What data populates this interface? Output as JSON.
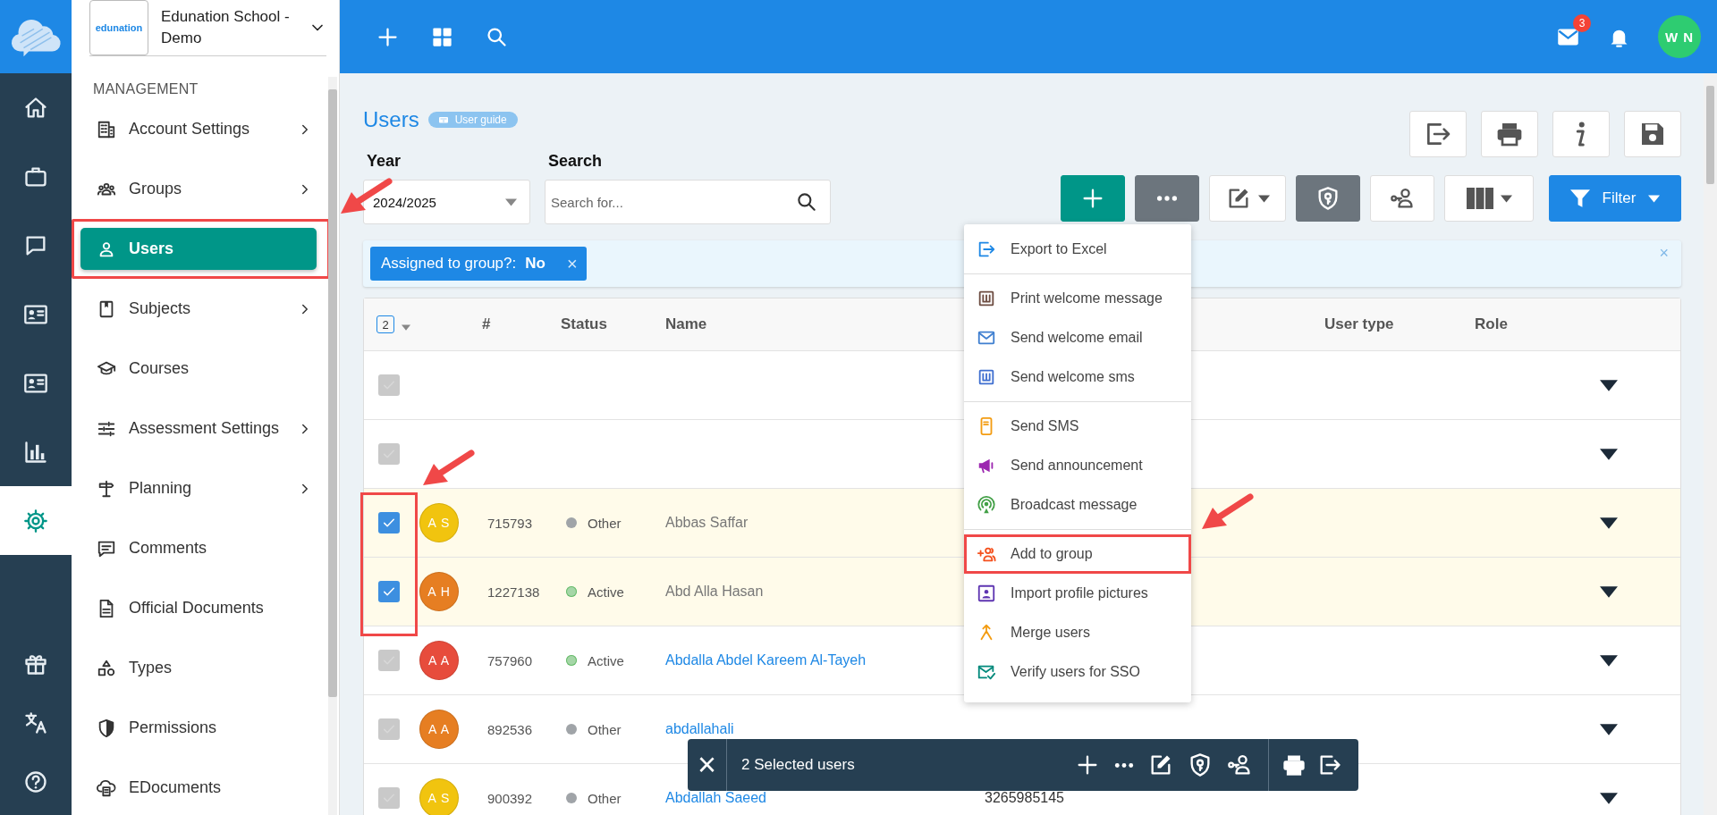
{
  "rail": [
    {
      "selected": false
    },
    {
      "selected": false
    },
    {
      "selected": false
    },
    {
      "selected": false
    },
    {
      "selected": false
    },
    {
      "selected": false
    },
    {
      "selected": true
    },
    {
      "selected": false
    },
    {
      "selected": false
    },
    {
      "selected": false
    }
  ],
  "organization": {
    "logo_text": "edunation",
    "name": "Edunation School - Demo"
  },
  "sidebar": {
    "section": "MANAGEMENT",
    "items": [
      {
        "label": "Account Settings",
        "has_children": true,
        "selected": false
      },
      {
        "label": "Groups",
        "has_children": true,
        "selected": false
      },
      {
        "label": "Users",
        "has_children": false,
        "selected": true,
        "annotated": true
      },
      {
        "label": "Subjects",
        "has_children": true,
        "selected": false
      },
      {
        "label": "Courses",
        "has_children": false,
        "selected": false
      },
      {
        "label": "Assessment Settings",
        "has_children": true,
        "selected": false
      },
      {
        "label": "Planning",
        "has_children": true,
        "selected": false
      },
      {
        "label": "Comments",
        "has_children": false,
        "selected": false
      },
      {
        "label": "Official Documents",
        "has_children": false,
        "selected": false
      },
      {
        "label": "Types",
        "has_children": false,
        "selected": false
      },
      {
        "label": "Permissions",
        "has_children": false,
        "selected": false
      },
      {
        "label": "EDocuments",
        "has_children": false,
        "selected": false
      }
    ]
  },
  "topbar": {
    "mail_badge": "3",
    "avatar": "W N"
  },
  "page": {
    "title": "Users",
    "guide": "User guide",
    "year_label": "Year",
    "year_value": "2024/2025",
    "search_label": "Search",
    "search_placeholder": "Search for..."
  },
  "filter_chips": [
    {
      "label": "Assigned to group?:",
      "value": "No",
      "remove": "×"
    }
  ],
  "clear_filters": "×",
  "filter_button": "Filter",
  "actions_menu": [
    {
      "label": "Export to Excel",
      "separator_after": true
    },
    {
      "label": "Print welcome message"
    },
    {
      "label": "Send welcome email"
    },
    {
      "label": "Send welcome sms",
      "separator_after": true
    },
    {
      "label": "Send SMS"
    },
    {
      "label": "Send announcement"
    },
    {
      "label": "Broadcast message",
      "separator_after": true
    },
    {
      "label": "Add to group",
      "annotated": true
    },
    {
      "label": "Import profile pictures"
    },
    {
      "label": "Merge users"
    },
    {
      "label": "Verify users for SSO"
    }
  ],
  "table": {
    "selected_count": "2",
    "columns": [
      "#",
      "Status",
      "Name",
      "User type",
      "Role"
    ],
    "checked_annotated": true,
    "rows": [
      {
        "checked": false
      },
      {
        "checked": false
      },
      {
        "checked": true,
        "initials": "A S",
        "color": "#f1c40f",
        "number": "715793",
        "status": "Other",
        "status_active": false,
        "name": "Abbas Saffar",
        "name_link": false
      },
      {
        "checked": true,
        "initials": "A H",
        "color": "#e67e22",
        "number": "1227138",
        "status": "Active",
        "status_active": true,
        "name": "Abd Alla Hasan",
        "name_link": false
      },
      {
        "checked": false,
        "initials": "A A",
        "color": "#e74c3c",
        "number": "757960",
        "status": "Active",
        "status_active": true,
        "name": "Abdalla Abdel Kareem Al-Tayeh",
        "name_link": true
      },
      {
        "checked": false,
        "initials": "A A",
        "color": "#e67e22",
        "number": "892536",
        "status": "Other",
        "status_active": false,
        "name": "abdallahali",
        "name_link": true
      },
      {
        "checked": false,
        "initials": "A S",
        "color": "#f1c40f",
        "number": "900392",
        "status": "Other",
        "status_active": false,
        "name": "Abdallah Saeed",
        "name_link": true,
        "phone": "3265985145"
      }
    ]
  },
  "selection_bar": {
    "close": "×",
    "label": "2 Selected users"
  }
}
